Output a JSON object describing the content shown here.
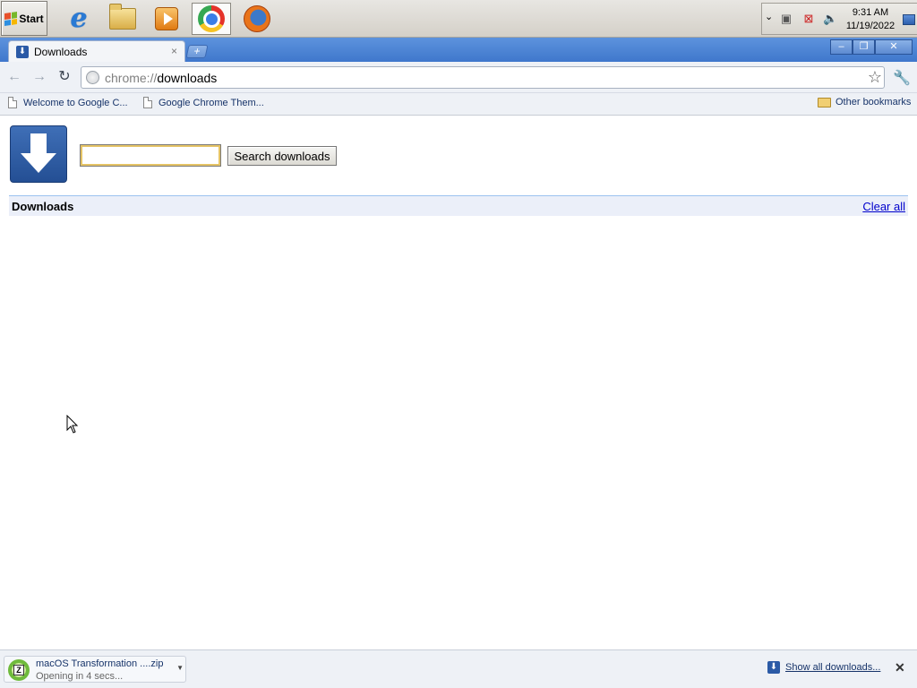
{
  "taskbar": {
    "start_label": "Start",
    "apps": [
      {
        "name": "Internet Explorer",
        "icon": "internet-explorer-icon"
      },
      {
        "name": "Windows Explorer",
        "icon": "folder-icon"
      },
      {
        "name": "Media Player",
        "icon": "media-player-icon"
      },
      {
        "name": "Google Chrome",
        "icon": "chrome-icon",
        "active": true
      },
      {
        "name": "Firefox",
        "icon": "firefox-icon"
      }
    ],
    "clock_time": "9:31 AM",
    "clock_date": "11/19/2022"
  },
  "window": {
    "tab_title": "Downloads",
    "tab_close": "×",
    "new_tab": "+",
    "controls": {
      "minimize": "–",
      "restore": "❐",
      "close": "✕"
    }
  },
  "toolbar": {
    "back": "←",
    "forward": "→",
    "reload": "↻",
    "url_scheme": "chrome://",
    "url_path": "downloads",
    "star": "☆",
    "wrench": "🔧"
  },
  "bookmarks": {
    "items": [
      "Welcome to Google C...",
      "Google Chrome Them..."
    ],
    "other": "Other bookmarks"
  },
  "page": {
    "search_value": "",
    "search_button": "Search downloads",
    "section_title": "Downloads",
    "clear_all": "Clear all"
  },
  "shelf": {
    "file_name": "macOS Transformation ....zip",
    "status": "Opening in 4 secs...",
    "show_all": "Show all downloads...",
    "close": "✕"
  },
  "colors": {
    "titlebar": "#4a83d4",
    "link": "#0000cc",
    "header_bg": "#ebeff9"
  }
}
